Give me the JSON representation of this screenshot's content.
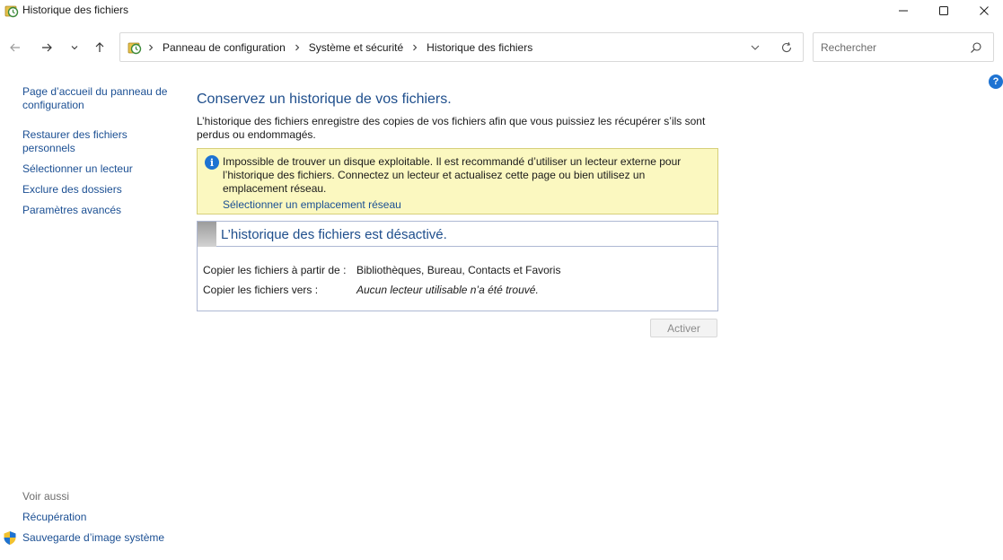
{
  "window": {
    "title": "Historique des fichiers"
  },
  "navigation": {
    "breadcrumbs": [
      {
        "label": "Panneau de configuration"
      },
      {
        "label": "Système et sécurité"
      },
      {
        "label": "Historique des fichiers"
      }
    ],
    "search_placeholder": "Rechercher"
  },
  "help": {
    "label": "?"
  },
  "sidebar": {
    "links": [
      {
        "label": "Page d’accueil du panneau de configuration"
      },
      {
        "label": "Restaurer des fichiers personnels"
      },
      {
        "label": "Sélectionner un lecteur"
      },
      {
        "label": "Exclure des dossiers"
      },
      {
        "label": "Paramètres avancés"
      }
    ],
    "see_also": {
      "heading": "Voir aussi",
      "links": [
        {
          "label": "Récupération"
        },
        {
          "label": "Sauvegarde d’image système"
        }
      ]
    }
  },
  "main": {
    "title": "Conservez un historique de vos fichiers.",
    "description": "L’historique des fichiers enregistre des copies de vos fichiers afin que vous puissiez les récupérer s’ils sont perdus ou endommagés.",
    "info": {
      "message": "Impossible de trouver un disque exploitable. Il est recommandé d’utiliser un lecteur externe pour l’historique des fichiers. Connectez un lecteur et actualisez cette page ou bien utilisez un emplacement réseau.",
      "link": "Sélectionner un emplacement réseau",
      "icon_glyph": "i"
    },
    "status": {
      "title": "L’historique des fichiers est désactivé.",
      "rows": [
        {
          "label": "Copier les fichiers à partir de :",
          "value": "Bibliothèques, Bureau, Contacts et Favoris"
        },
        {
          "label": "Copier les fichiers vers :",
          "value": "Aucun lecteur utilisable n’a été trouvé."
        }
      ]
    },
    "activate_button": "Activer"
  },
  "colors": {
    "link": "#1b4f93",
    "heading": "#1e4e8c",
    "info_background": "#fbf8c0",
    "accent": "#1e73d2"
  }
}
